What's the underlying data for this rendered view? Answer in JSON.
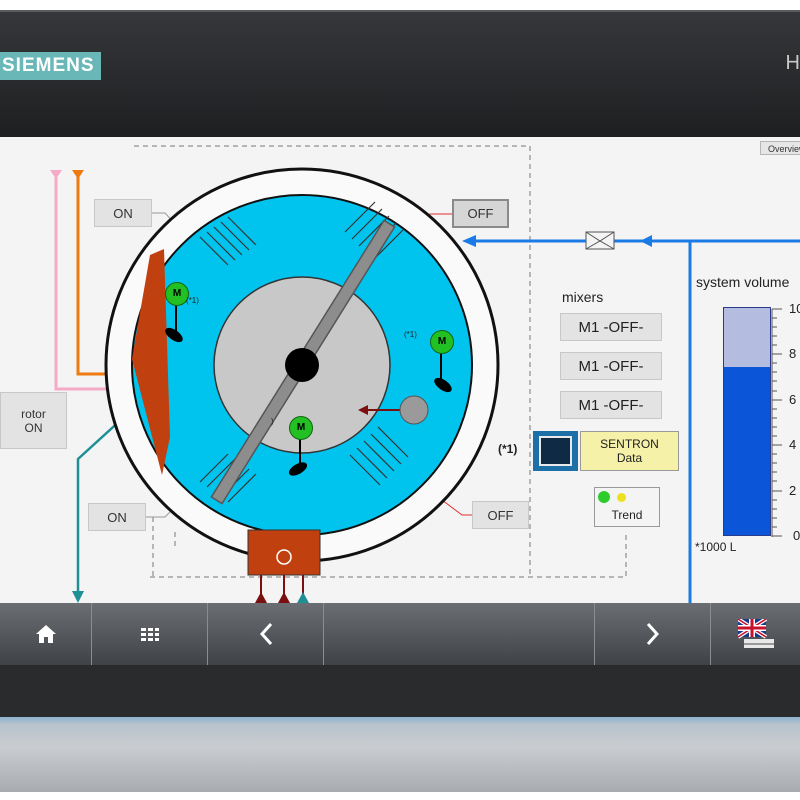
{
  "device": {
    "brand": "SIEMENS",
    "model_text": "H"
  },
  "screen": {
    "overview_label": "Overview",
    "buttons": {
      "on_top": "ON",
      "off_top": "OFF",
      "on_bottom": "ON",
      "off_bottom": "OFF",
      "rotor_line1": "rotor",
      "rotor_line2": "ON"
    },
    "motors": [
      {
        "label": "M",
        "note": "(*1)"
      },
      {
        "label": "M",
        "note": "(*1)"
      },
      {
        "label": "M",
        "note": ")"
      }
    ],
    "mixers": {
      "title": "mixers",
      "items": [
        "M1 -OFF-",
        "M1 -OFF-",
        "M1 -OFF-"
      ]
    },
    "footnote_marker": "(*1)",
    "sentron": {
      "line1": "SENTRON",
      "line2": "Data"
    },
    "trend_label": "Trend",
    "volume": {
      "title": "system volume",
      "unit": "*1000 L",
      "tick_labels": [
        "10",
        "8",
        "6",
        "4",
        "2",
        "0"
      ],
      "level_fraction": 0.74,
      "colors": {
        "fill": "#0a55d8",
        "empty": "#b4bde0"
      }
    }
  },
  "nav": {
    "icons": [
      "home-icon",
      "grid-icon",
      "chevron-left-icon",
      "chevron-right-icon",
      "flag-uk-icon"
    ]
  },
  "colors": {
    "tank_water": "#00c4ee",
    "tank_center": "#c8c8c8",
    "heater": "#c0410f",
    "pipe_blue": "#1a7ae6",
    "pipe_orange": "#ee7a10",
    "pipe_pink": "#f5aac8",
    "pipe_teal": "#1f8f96",
    "brand": "#6ab7b8"
  }
}
